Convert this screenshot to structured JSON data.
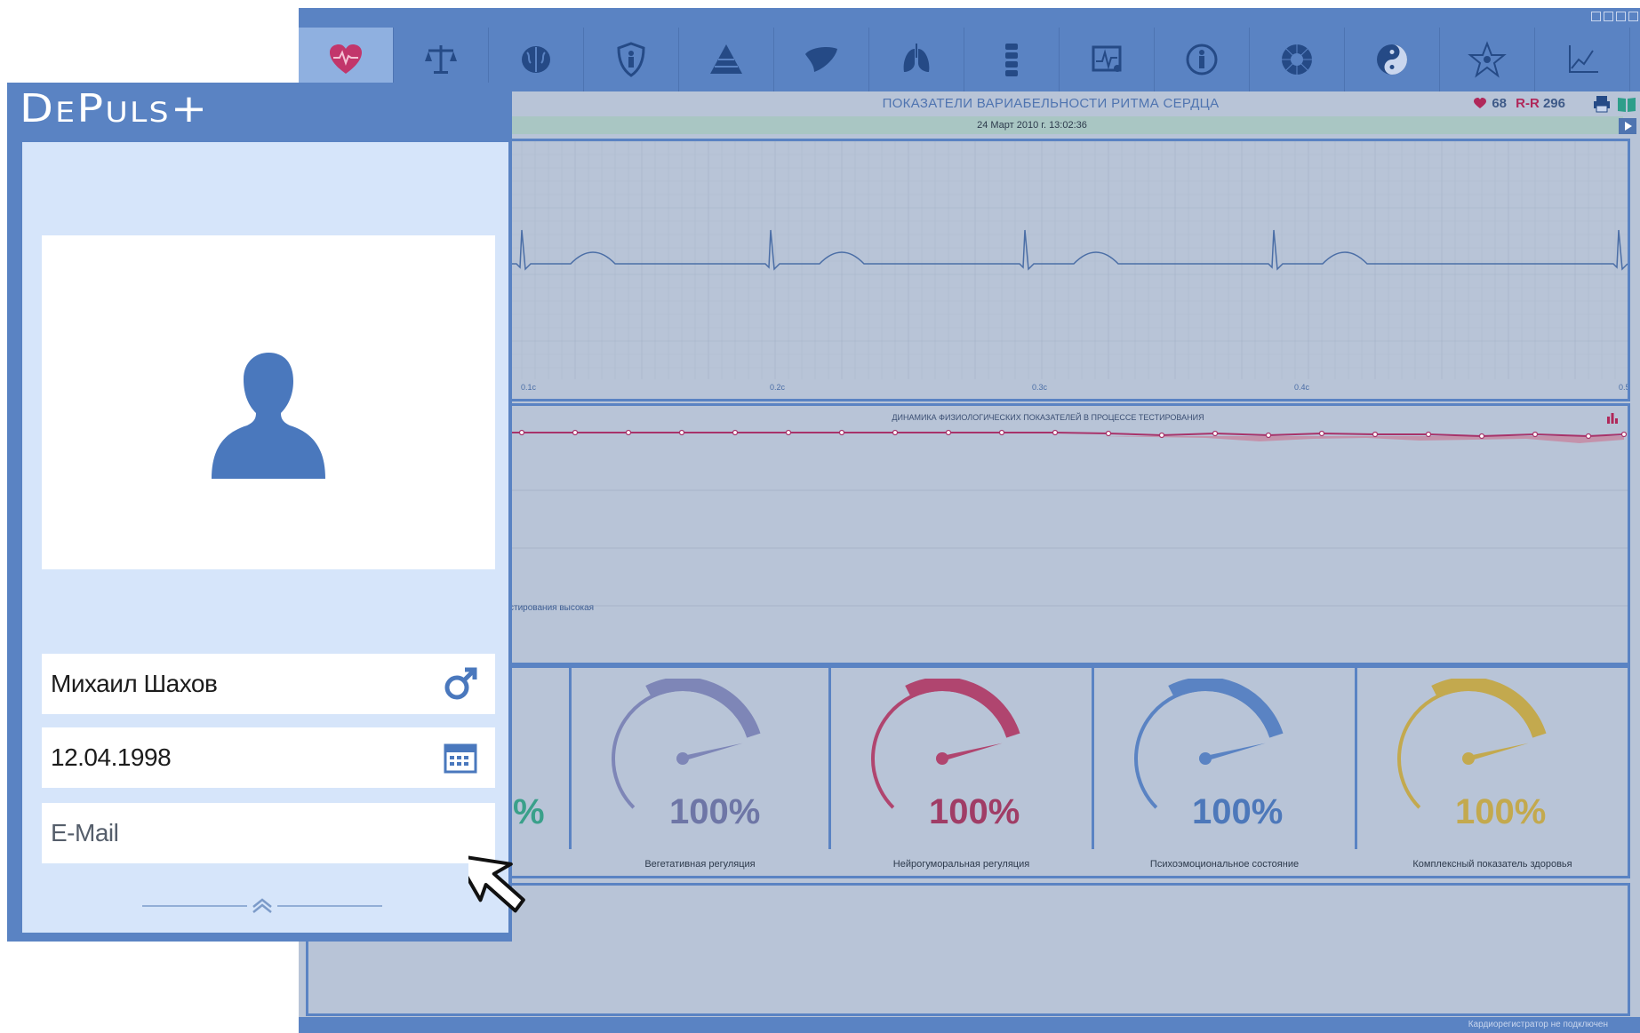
{
  "app": {
    "title": "ПОКАЗАТЕЛИ ВАРИАБЕЛЬНОСТИ РИТМА СЕРДЦА",
    "date": "24 Март 2010 г. 13:02:36",
    "heart_rate": "68",
    "rr_label": "R-R",
    "rr_value": "296",
    "status": "Кардиорегистратор не подключен",
    "toolbar": [
      {
        "name": "heart-icon",
        "active": true
      },
      {
        "name": "scales-icon"
      },
      {
        "name": "brain-icon"
      },
      {
        "name": "shield-icon"
      },
      {
        "name": "pyramid-icon"
      },
      {
        "name": "liver-icon"
      },
      {
        "name": "lungs-icon"
      },
      {
        "name": "spine-icon"
      },
      {
        "name": "cardiogram-icon"
      },
      {
        "name": "person-circle-icon"
      },
      {
        "name": "sun-icon"
      },
      {
        "name": "yin-yang-icon"
      },
      {
        "name": "star-icon"
      },
      {
        "name": "line-chart-icon"
      }
    ],
    "ecg": {
      "axis_ticks": [
        "0.1c",
        "0.2c",
        "0.3c",
        "0.4c",
        "0.5"
      ]
    },
    "dynamics": {
      "title": "ДИНАМИКА ФИЗИОЛОГИЧЕСКИХ ПОКАЗАТЕЛЕЙ В ПРОЦЕССЕ ТЕСТИРОВАНИЯ",
      "note": "стирования высокая"
    },
    "gauges": [
      {
        "label": "Вегетативная регуляция",
        "value": "100%",
        "level": 1.0,
        "color": "#7e86b7"
      },
      {
        "label": "Нейрогуморальная регуляция",
        "value": "100%",
        "level": 1.0,
        "color": "#b0456f"
      },
      {
        "label": "Психоэмоциональное состояние",
        "value": "100%",
        "level": 1.0,
        "color": "#5a83c3"
      },
      {
        "label": "Комплексный показатель здоровья",
        "value": "100%",
        "level": 1.0,
        "color": "#c3a94e"
      }
    ],
    "partial_gauge_value": "%",
    "colors": {
      "accent": "#5a83c3",
      "panel": "#b8c4d7",
      "heart": "#b0285a"
    }
  },
  "card": {
    "logo": "DePuls+",
    "name": "Михаил Шахов",
    "gender_icon": "male-icon",
    "dob": "12.04.1998",
    "email_placeholder": "E-Mail"
  }
}
